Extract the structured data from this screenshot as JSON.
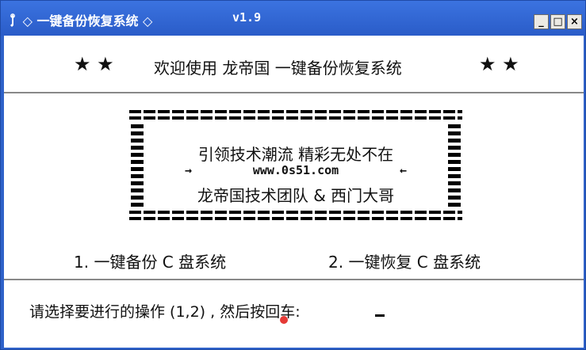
{
  "window": {
    "title": "◇ 一键备份恢复系统 ◇",
    "version": "v1.9",
    "minimize_label": "_",
    "maximize_label": "□",
    "close_label": "×",
    "icon": "tool-icon"
  },
  "header": {
    "stars_left": "★ ★",
    "welcome": "欢迎使用 龙帝国 一键备份恢复系统",
    "stars_right": "★ ★"
  },
  "banner": {
    "line1": "引领技术潮流 精彩无处不在",
    "arrow_left": "→",
    "site": "www.0s51.com",
    "arrow_right": "←",
    "line3": "龙帝国技术团队 & 西门大哥"
  },
  "options": {
    "option1": "1. 一键备份 C 盘系统",
    "option2": "2. 一键恢复 C 盘系统"
  },
  "prompt": {
    "text": "请选择要进行的操作 (1,2) , 然后按回车:",
    "cursor": "_"
  },
  "colors": {
    "titlebar": "#2a5cc8",
    "client_bg": "#ffffff",
    "marker": "#e53935"
  }
}
